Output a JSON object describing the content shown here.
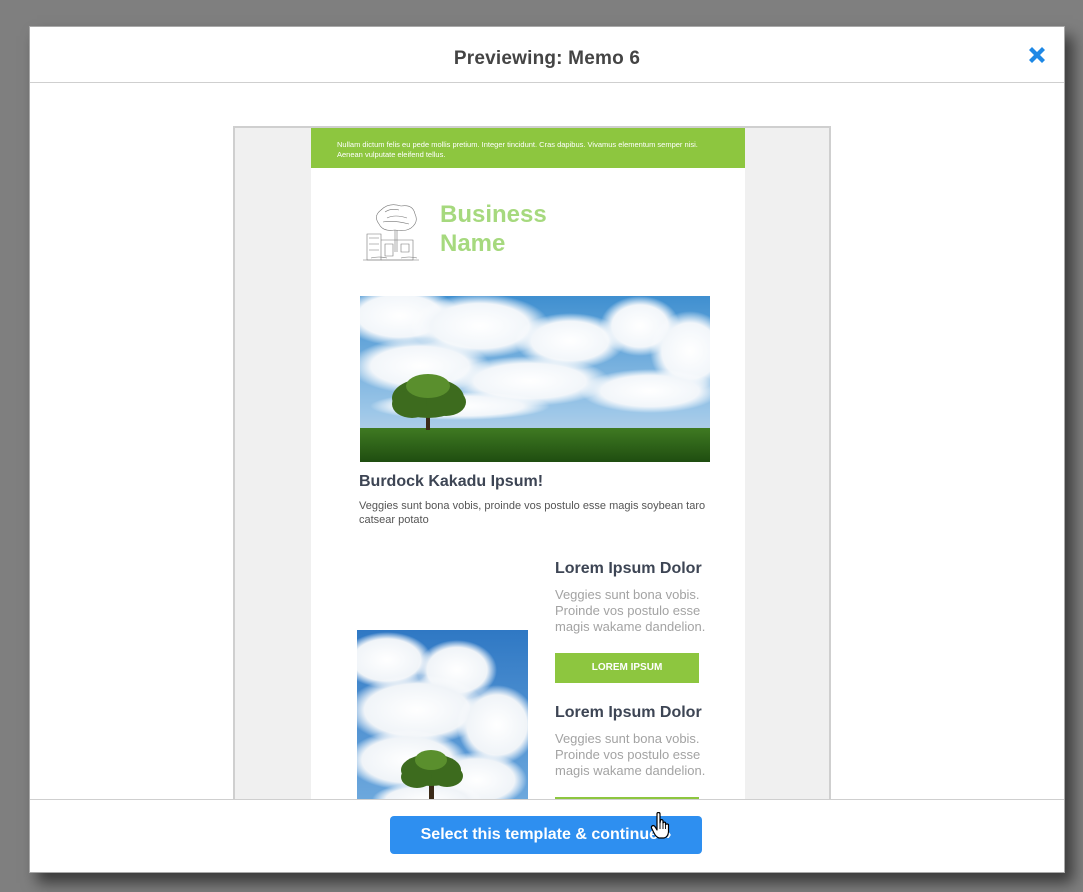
{
  "modal": {
    "title": "Previewing: Memo 6",
    "close_icon": "close-x-icon",
    "close_color": "#1e88e5"
  },
  "email": {
    "top_bar_text": "Nullam dictum felis eu pede mollis pretium. Integer tincidunt. Cras dapibus. Vivamus elementum semper nisi. Aenean vulputate eleifend tellus.",
    "logo_icon": "sketch-logo-icon",
    "business_name_line1": "Business",
    "business_name_line2": "Name",
    "hero_image": "landscape-tree-clouds-image",
    "headline": "Burdock Kakadu Ipsum!",
    "headline_body": "Veggies sunt bona vobis, proinde vos postulo esse magis soybean taro catsear potato",
    "side_image": "clouds-tree-image",
    "columns": [
      {
        "title": "Lorem Ipsum Dolor",
        "body": "Veggies sunt bona vobis. Proinde vos postulo esse magis wakame dandelion.",
        "button": "LOREM IPSUM"
      },
      {
        "title": "Lorem Ipsum Dolor",
        "body": "Veggies sunt bona vobis. Proinde vos postulo esse magis wakame dandelion.",
        "button": ""
      }
    ],
    "accent_color": "#8dc63f"
  },
  "footer": {
    "cta_label": "Select this template & continue »",
    "cta_color": "#2e8ff0"
  }
}
